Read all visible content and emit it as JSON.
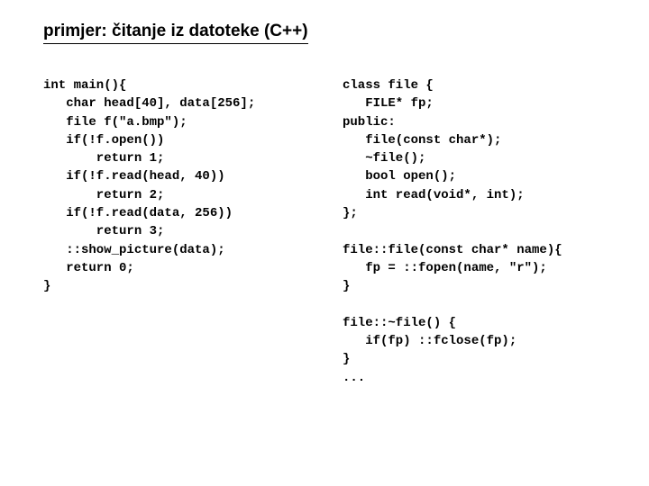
{
  "title": "primjer: čitanje iz datoteke (C++)",
  "left_code": "int main(){\n   char head[40], data[256];\n   file f(\"a.bmp\");\n   if(!f.open())\n       return 1;\n   if(!f.read(head, 40))\n       return 2;\n   if(!f.read(data, 256))\n       return 3;\n   ::show_picture(data);\n   return 0;\n}",
  "right_code": "class file {\n   FILE* fp;\npublic:\n   file(const char*);\n   ~file();\n   bool open();\n   int read(void*, int);\n};\n\nfile::file(const char* name){\n   fp = ::fopen(name, \"r\");\n}\n\nfile::~file() {\n   if(fp) ::fclose(fp);\n}\n..."
}
